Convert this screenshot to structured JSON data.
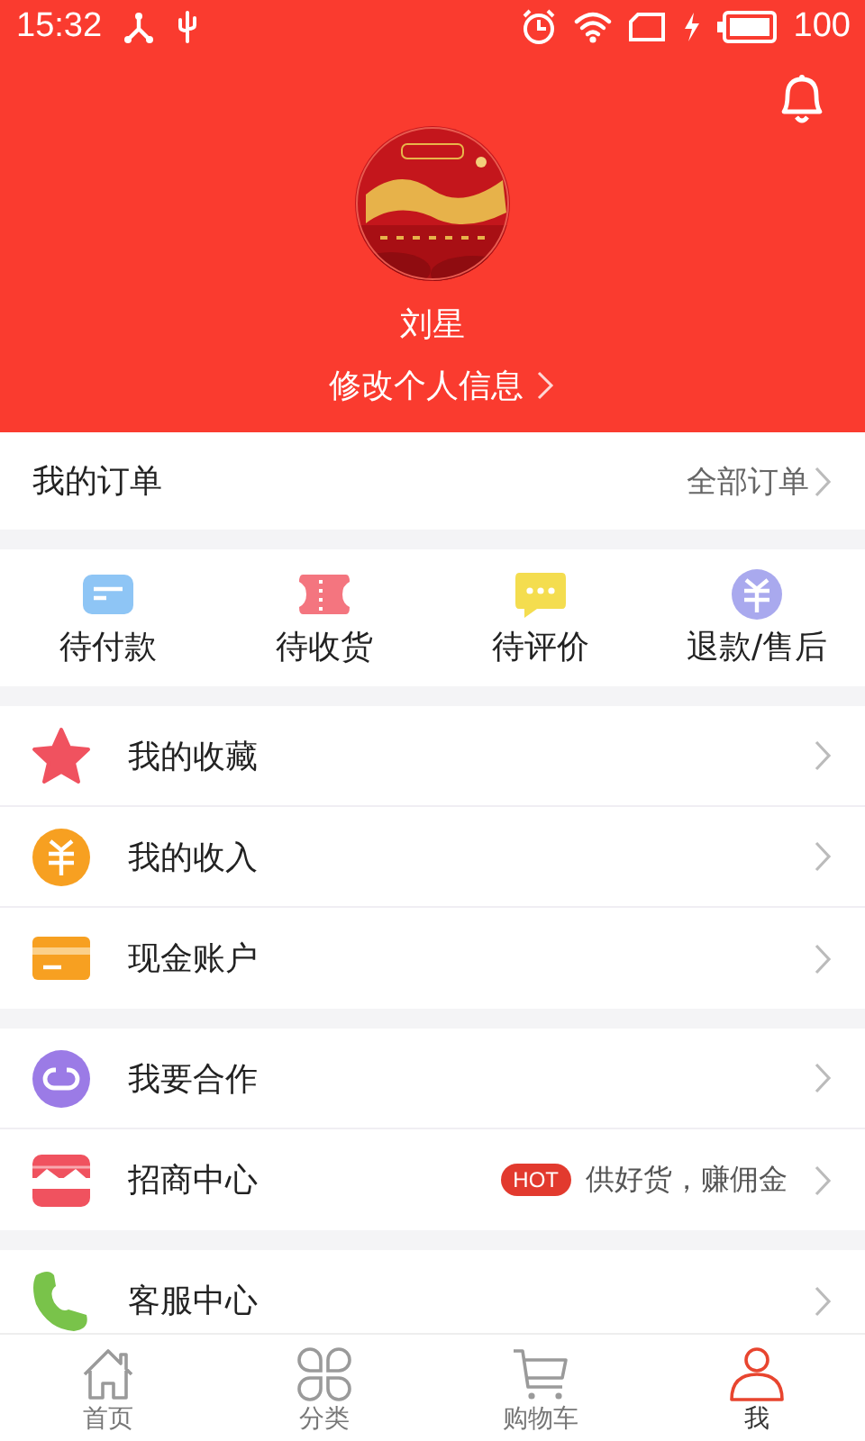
{
  "status_bar": {
    "time": "15:32",
    "battery": "100"
  },
  "profile": {
    "name": "刘星",
    "edit_link": "修改个人信息"
  },
  "orders": {
    "title": "我的订单",
    "all_link": "全部订单"
  },
  "order_states": [
    {
      "label": "待付款"
    },
    {
      "label": "待收货"
    },
    {
      "label": "待评价"
    },
    {
      "label": "退款/售后"
    }
  ],
  "menu_groups": [
    {
      "items": [
        {
          "label": "我的收藏"
        },
        {
          "label": "我的收入"
        },
        {
          "label": "现金账户"
        }
      ]
    },
    {
      "items": [
        {
          "label": "我要合作"
        },
        {
          "label": "招商中心",
          "badge": "HOT",
          "note": "供好货，赚佣金"
        }
      ]
    },
    {
      "items": [
        {
          "label": "客服中心"
        }
      ]
    }
  ],
  "tab_bar": [
    {
      "label": "首页",
      "selected": false
    },
    {
      "label": "分类",
      "selected": false
    },
    {
      "label": "购物车",
      "selected": false
    },
    {
      "label": "我",
      "selected": true
    }
  ]
}
